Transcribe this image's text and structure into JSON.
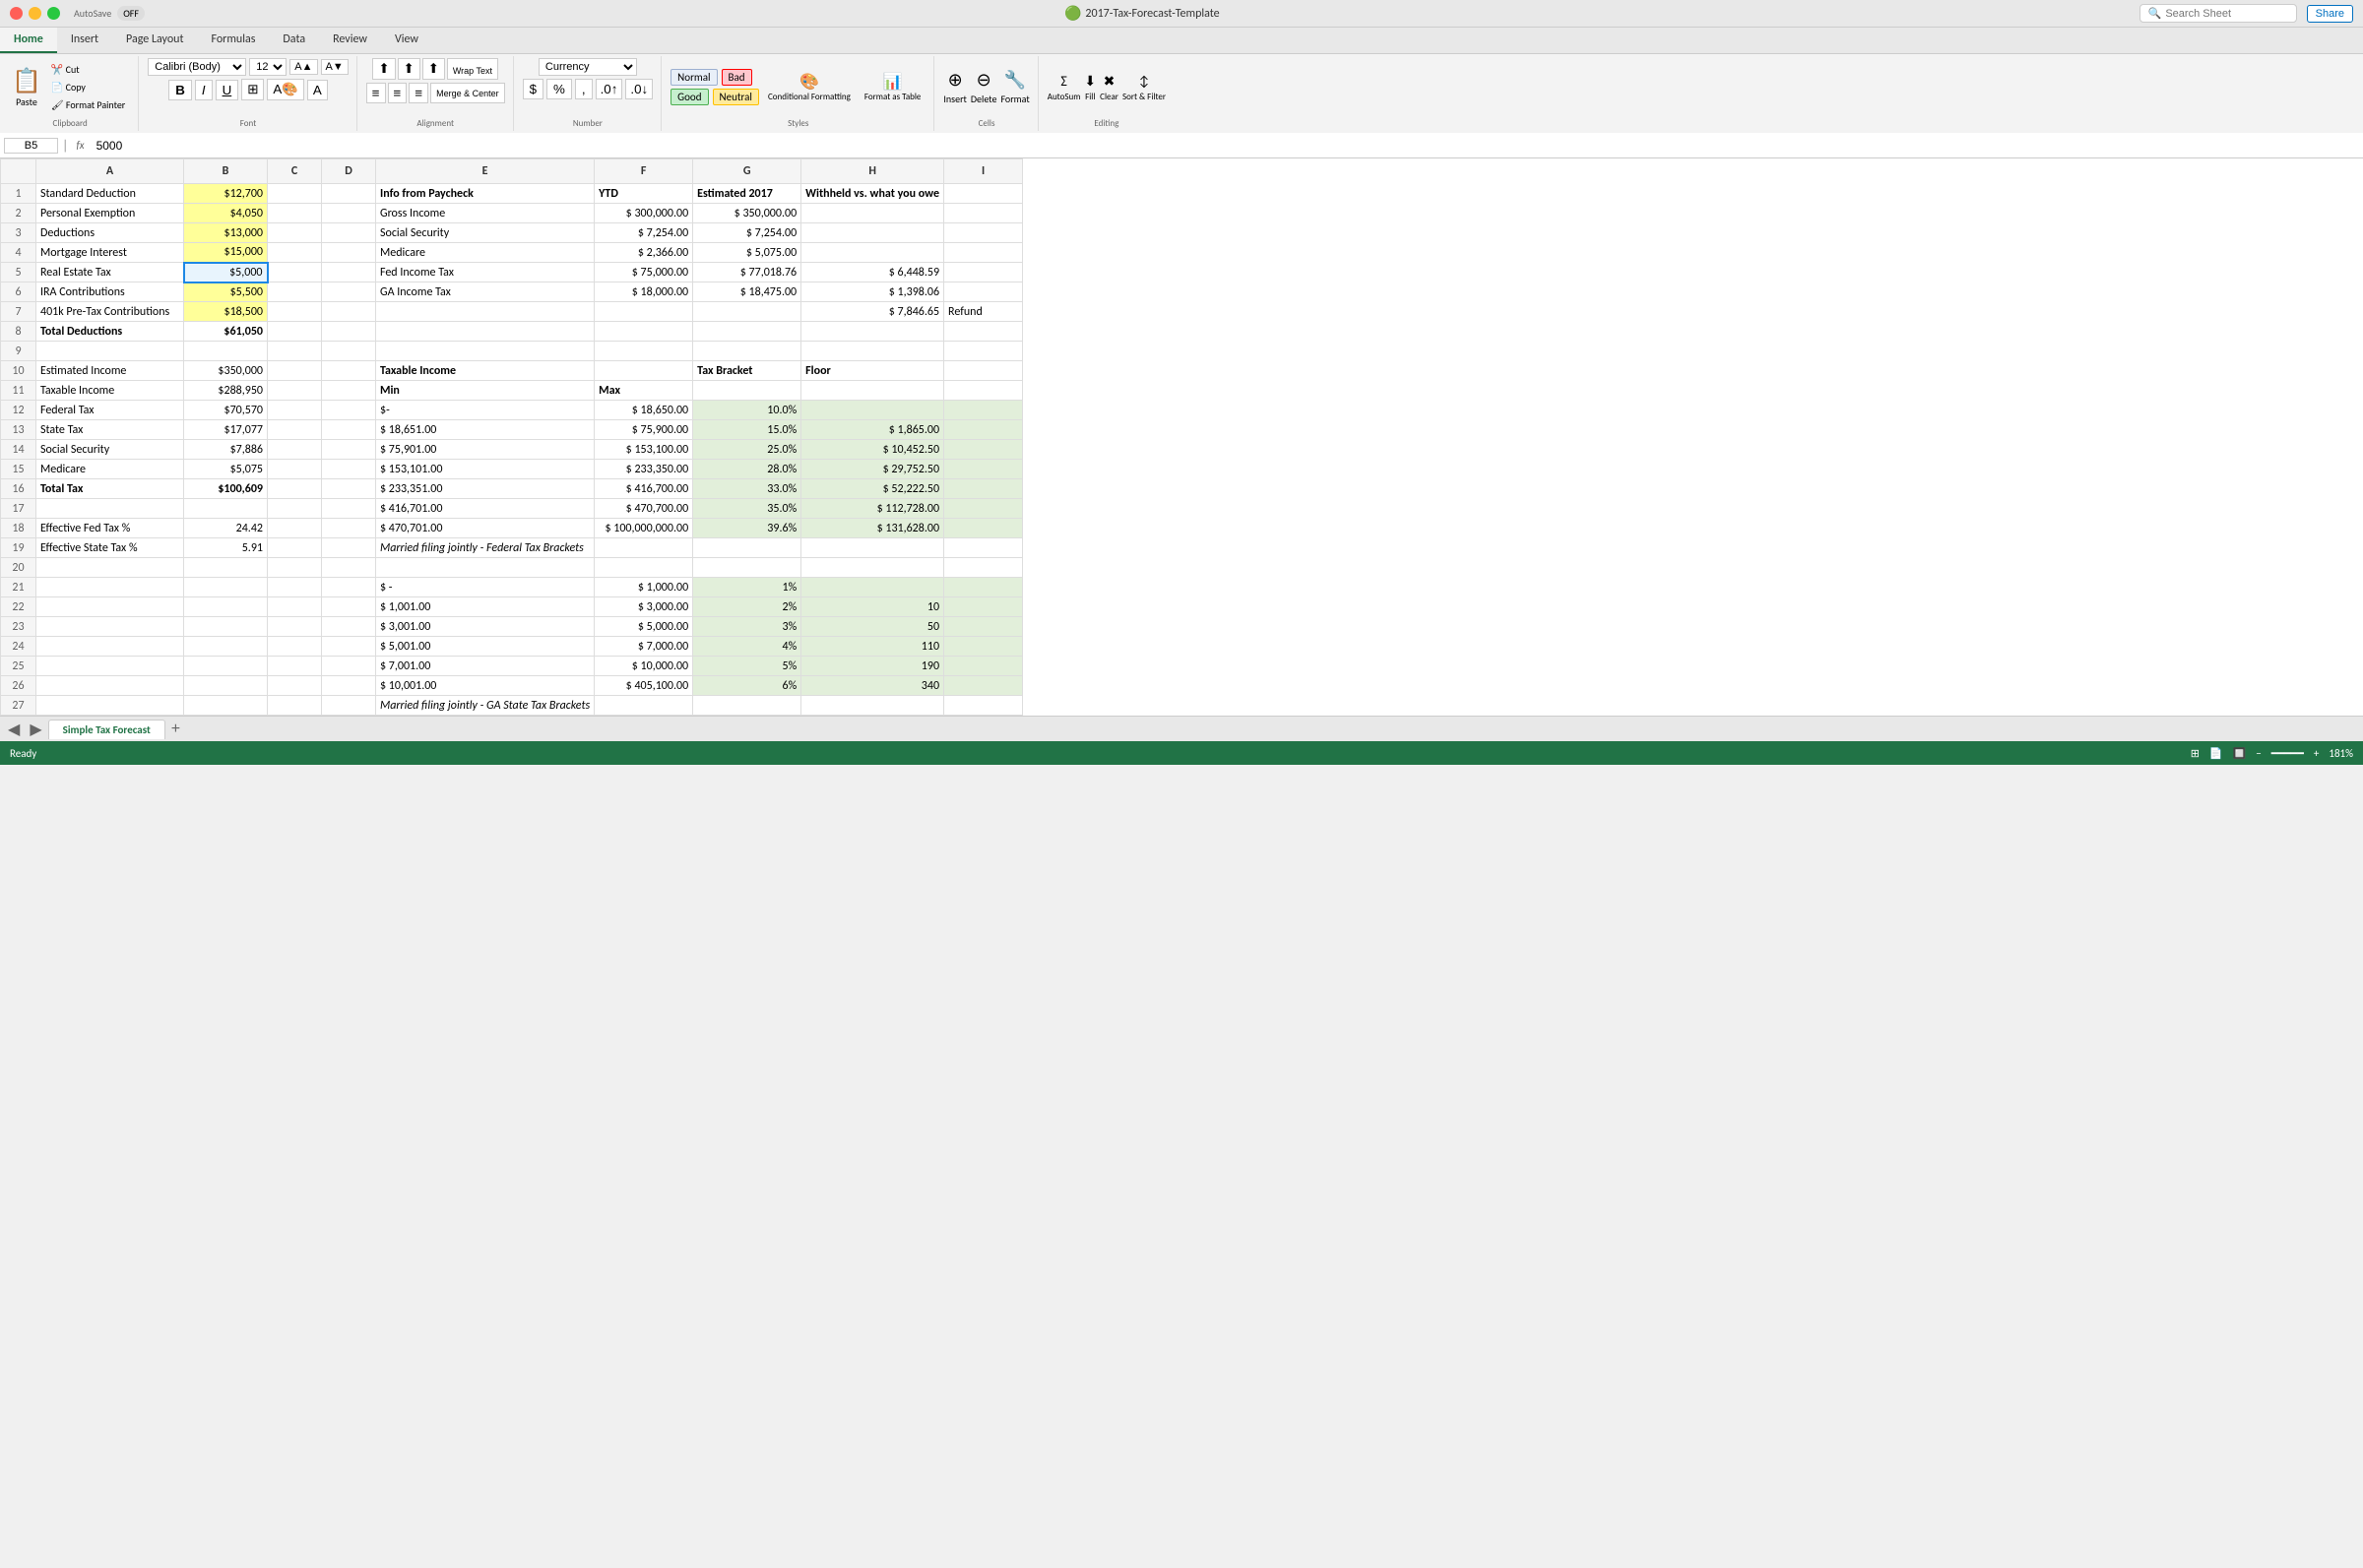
{
  "titleBar": {
    "windowTitle": "2017-Tax-Forecast-Template",
    "autosave": "AutoSave",
    "autosaveState": "OFF",
    "shareLabel": "Share",
    "searchPlaceholder": "Search Sheet"
  },
  "ribbon": {
    "tabs": [
      "Home",
      "Insert",
      "Page Layout",
      "Formulas",
      "Data",
      "Review",
      "View"
    ],
    "activeTab": "Home",
    "clipboard": {
      "paste": "Paste",
      "cut": "Cut",
      "copy": "Copy",
      "formatPainter": "Format Painter"
    },
    "font": {
      "name": "Calibri (Body)",
      "size": "12",
      "bold": "B",
      "italic": "I",
      "underline": "U"
    },
    "alignment": {
      "wrapText": "Wrap Text",
      "mergeCenter": "Merge & Center"
    },
    "number": {
      "format": "Currency",
      "dollar": "$",
      "percent": "%",
      "comma": ","
    },
    "styles": {
      "normal": "Normal",
      "bad": "Bad",
      "good": "Good",
      "neutral": "Neutral"
    },
    "cells": {
      "insert": "Insert",
      "delete": "Delete",
      "format": "Format"
    },
    "editing": {
      "autoSum": "AutoSum",
      "fill": "Fill",
      "clear": "Clear",
      "sortFilter": "Sort & Filter"
    },
    "conditionalFormatting": "Conditional Formatting",
    "formatAsTable": "Format as Table"
  },
  "formulaBar": {
    "cellRef": "B5",
    "formula": "5000",
    "fxLabel": "fx"
  },
  "columns": [
    "A",
    "B",
    "C",
    "D",
    "E",
    "F",
    "G",
    "H",
    "I"
  ],
  "rows": [
    {
      "num": 1,
      "a": "Standard Deduction",
      "b": "$12,700",
      "e": "Info from Paycheck",
      "f": "YTD",
      "g": "Estimated 2017",
      "h": "Withheld vs. what you owe",
      "bStyle": "yellow",
      "eStyle": "bold"
    },
    {
      "num": 2,
      "a": "Personal Exemption",
      "b": "$4,050",
      "e": "Gross Income",
      "f": "$     300,000.00",
      "g": "$     350,000.00",
      "bStyle": "yellow"
    },
    {
      "num": 3,
      "a": "Deductions",
      "b": "$13,000",
      "e": "Social Security",
      "f": "$       7,254.00",
      "g": "$       7,254.00",
      "bStyle": "yellow"
    },
    {
      "num": 4,
      "a": "Mortgage Interest",
      "b": "$15,000",
      "e": "Medicare",
      "f": "$       2,366.00",
      "g": "$       5,075.00",
      "bStyle": "yellow"
    },
    {
      "num": 5,
      "a": "Real Estate Tax",
      "b": "$5,000",
      "e": "Fed Income Tax",
      "f": "$      75,000.00",
      "g": "$      77,018.76",
      "h": "$         6,448.59",
      "bStyle": "selected"
    },
    {
      "num": 6,
      "a": "IRA Contributions",
      "b": "$5,500",
      "e": "GA Income Tax",
      "f": "$      18,000.00",
      "g": "$      18,475.00",
      "h": "$         1,398.06",
      "bStyle": "yellow"
    },
    {
      "num": 7,
      "a": "401k Pre-Tax Contributions",
      "b": "$18,500",
      "h": "$         7,846.65",
      "i": "Refund",
      "bStyle": "yellow"
    },
    {
      "num": 8,
      "a": "Total Deductions",
      "b": "$61,050",
      "aStyle": "bold",
      "bStyle": "bold"
    },
    {
      "num": 9,
      "a": ""
    },
    {
      "num": 10,
      "a": "Estimated Income",
      "b": "$350,000",
      "e": "Taxable Income",
      "g": "Tax Bracket",
      "h": "Floor",
      "eStyle": "bold"
    },
    {
      "num": 11,
      "a": "Taxable Income",
      "b": "$288,950",
      "e": "Min",
      "f": "Max"
    },
    {
      "num": 12,
      "a": "Federal Tax",
      "b": "$70,570",
      "e": "$-",
      "f": "$      18,650.00",
      "g": "10.0%",
      "gStyle": "green"
    },
    {
      "num": 13,
      "a": "State Tax",
      "b": "$17,077",
      "e": "$      18,651.00",
      "f": "$      75,900.00",
      "g": "15.0%",
      "h": "$      1,865.00",
      "gStyle": "green"
    },
    {
      "num": 14,
      "a": "Social Security",
      "b": "$7,886",
      "e": "$      75,901.00",
      "f": "$    153,100.00",
      "g": "25.0%",
      "h": "$    10,452.50",
      "gStyle": "green"
    },
    {
      "num": 15,
      "a": "Medicare",
      "b": "$5,075",
      "e": "$    153,101.00",
      "f": "$    233,350.00",
      "g": "28.0%",
      "h": "$    29,752.50",
      "gStyle": "green"
    },
    {
      "num": 16,
      "a": "Total Tax",
      "b": "$100,609",
      "e": "$    233,351.00",
      "f": "$    416,700.00",
      "g": "33.0%",
      "h": "$    52,222.50",
      "aStyle": "bold",
      "bStyle": "bold",
      "gStyle": "green"
    },
    {
      "num": 17,
      "a": "",
      "e": "$    416,701.00",
      "f": "$    470,700.00",
      "g": "35.0%",
      "h": "$  112,728.00",
      "gStyle": "green"
    },
    {
      "num": 18,
      "a": "Effective Fed Tax %",
      "b": "24.42",
      "e": "$    470,701.00",
      "f": "$ 100,000,000.00",
      "g": "39.6%",
      "h": "$  131,628.00",
      "gStyle": "green"
    },
    {
      "num": 19,
      "a": "Effective State Tax %",
      "b": "5.91",
      "e": "Married filing jointly - Federal Tax Brackets",
      "eStyle": "italic"
    },
    {
      "num": 20,
      "a": ""
    },
    {
      "num": 21,
      "a": "",
      "e": "$             -",
      "f": "$       1,000.00",
      "g": "1%"
    },
    {
      "num": 22,
      "a": "",
      "e": "$       1,001.00",
      "f": "$       3,000.00",
      "g": "2%",
      "h": "10"
    },
    {
      "num": 23,
      "a": "",
      "e": "$       3,001.00",
      "f": "$       5,000.00",
      "g": "3%",
      "h": "50"
    },
    {
      "num": 24,
      "a": "",
      "e": "$       5,001.00",
      "f": "$       7,000.00",
      "g": "4%",
      "h": "110"
    },
    {
      "num": 25,
      "a": "",
      "e": "$       7,001.00",
      "f": "$      10,000.00",
      "g": "5%",
      "h": "190"
    },
    {
      "num": 26,
      "a": "",
      "e": "$      10,001.00",
      "f": "$    405,100.00",
      "g": "6%",
      "h": "340"
    },
    {
      "num": 27,
      "a": "",
      "e": "Married filing jointly - GA State Tax Brackets",
      "eStyle": "italic"
    }
  ],
  "sheetTabs": [
    "Simple Tax Forecast"
  ],
  "statusBar": {
    "ready": "Ready",
    "zoom": "181%"
  }
}
